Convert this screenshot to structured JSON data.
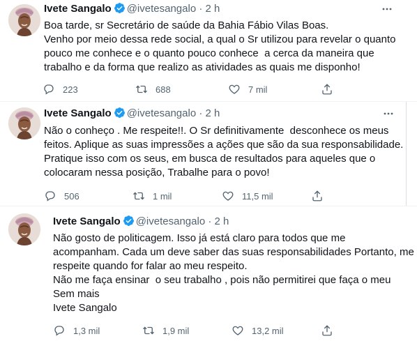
{
  "tweets": [
    {
      "name": "Ivete Sangalo",
      "handle": "@ivetesangalo",
      "dot": "·",
      "time": "2 h",
      "lines": [
        "Boa tarde, sr Secretário de saúde da Bahia Fábio Vilas Boas.",
        "Venho por meio dessa rede social, a qual o Sr utilizou para revelar o quanto",
        "pouco me conhece e o quanto pouco conhece  a cerca da maneira que",
        "trabalho e da forma que realizo as atividades as quais me disponho!"
      ],
      "replies": "223",
      "retweets": "688",
      "likes": "7 mil"
    },
    {
      "name": "Ivete Sangalo",
      "handle": "@ivetesangalo",
      "dot": "·",
      "time": "2 h",
      "lines": [
        "Não o conheço . Me respeite!!. O Sr definitivamente  desconhece os meus",
        "feitos. Aplique as suas impressões a ações que são da sua responsabilidade.",
        "Pratique isso com os seus, em busca de resultados para aqueles que o",
        "colocaram nessa posição, Trabalhe para o povo!"
      ],
      "replies": "506",
      "retweets": "1 mil",
      "likes": "11,5 mil"
    },
    {
      "name": "Ivete Sangalo",
      "handle": "@ivetesangalo",
      "dot": "·",
      "time": "2 h",
      "lines": [
        "Não gosto de politicagem. Isso já está claro para todos que me",
        "acompanham. Cada um deve saber das suas responsabilidades Portanto, me",
        "respeite quando for falar ao meu respeito.",
        "Não me faça ensinar  o seu trabalho , pois não permitirei que faça o meu",
        "Sem mais",
        "Ivete Sangalo"
      ],
      "replies": "1,3 mil",
      "retweets": "1,9 mil",
      "likes": "13,2 mil"
    }
  ],
  "colors": {
    "verified": "#1d9bf0",
    "secondary_text": "#536471",
    "separator": "#eff3f4"
  },
  "icons": [
    "more-icon",
    "verified-badge-icon",
    "reply-icon",
    "retweet-icon",
    "like-icon",
    "share-icon"
  ]
}
